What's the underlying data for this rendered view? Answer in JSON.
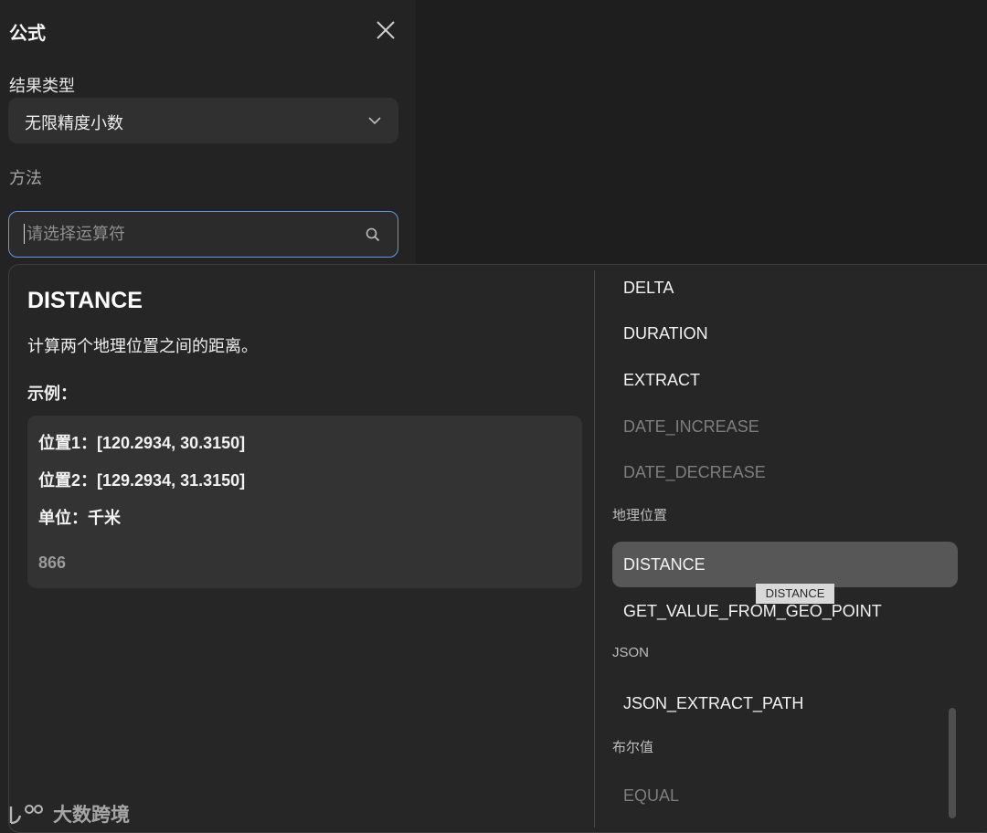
{
  "panel": {
    "title": "公式",
    "result_type_label": "结果类型",
    "result_type_value": "无限精度小数",
    "method_label": "方法",
    "search_placeholder": "请选择运算符"
  },
  "detail": {
    "title": "DISTANCE",
    "description": "计算两个地理位置之间的距离。",
    "example_label": "示例：",
    "example_lines": [
      "位置1：[120.2934, 30.3150]",
      "位置2：[129.2934, 31.3150]",
      "单位：千米"
    ],
    "example_result": "866"
  },
  "list": {
    "items": [
      {
        "label": "DELTA",
        "disabled": false
      },
      {
        "label": "DURATION",
        "disabled": false
      },
      {
        "label": "EXTRACT",
        "disabled": false
      },
      {
        "label": "DATE_INCREASE",
        "disabled": true
      },
      {
        "label": "DATE_DECREASE",
        "disabled": true
      }
    ],
    "groups": [
      {
        "label": "地理位置"
      },
      {
        "label": "JSON"
      },
      {
        "label": "布尔值"
      }
    ],
    "geo_items": [
      {
        "label": "DISTANCE",
        "selected": true
      },
      {
        "label": "GET_VALUE_FROM_GEO_POINT"
      }
    ],
    "json_items": [
      {
        "label": "JSON_EXTRACT_PATH"
      }
    ],
    "bool_items": [
      {
        "label": "EQUAL",
        "disabled": true
      }
    ],
    "tooltip": "DISTANCE"
  },
  "watermark": "大数跨境",
  "colors": {
    "focus_border": "#5b9be9",
    "selected_bg": "#575757",
    "panel_bg": "#232323"
  }
}
